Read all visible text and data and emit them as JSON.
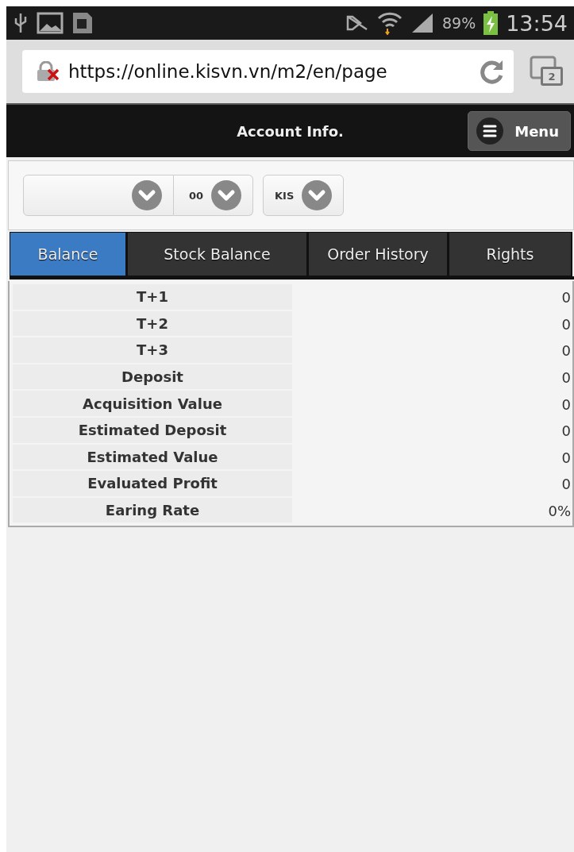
{
  "status_bar": {
    "battery": "89%",
    "time": "13:54"
  },
  "browser": {
    "url": "https://online.kisvn.vn/m2/en/page",
    "tab_count": "2"
  },
  "header": {
    "title": "Account Info.",
    "menu_button": "Menu"
  },
  "selector_groups": [
    {
      "selects": [
        {
          "kind": "wide"
        },
        {
          "kind": "narrow",
          "value": "00"
        }
      ]
    },
    {
      "selects": [
        {
          "kind": "narrow",
          "value": "KIS"
        }
      ]
    }
  ],
  "tabs": [
    {
      "label": "Balance",
      "selected": true
    },
    {
      "label": "Stock Balance",
      "selected": false
    },
    {
      "label": "Order History",
      "selected": false
    },
    {
      "label": "Rights",
      "selected": false
    }
  ],
  "table": {
    "rows": [
      {
        "label": "T+1",
        "value": "0"
      },
      {
        "label": "T+2",
        "value": "0"
      },
      {
        "label": "T+3",
        "value": "0"
      },
      {
        "label": "Deposit",
        "value": "0"
      },
      {
        "label": "Acquisition Value",
        "value": "0"
      },
      {
        "label": "Estimated Deposit",
        "value": "0"
      },
      {
        "label": "Estimated Value",
        "value": "0"
      },
      {
        "label": "Evaluated Profit",
        "value": "0"
      },
      {
        "label": "Earing Rate",
        "value": "0%"
      }
    ]
  }
}
